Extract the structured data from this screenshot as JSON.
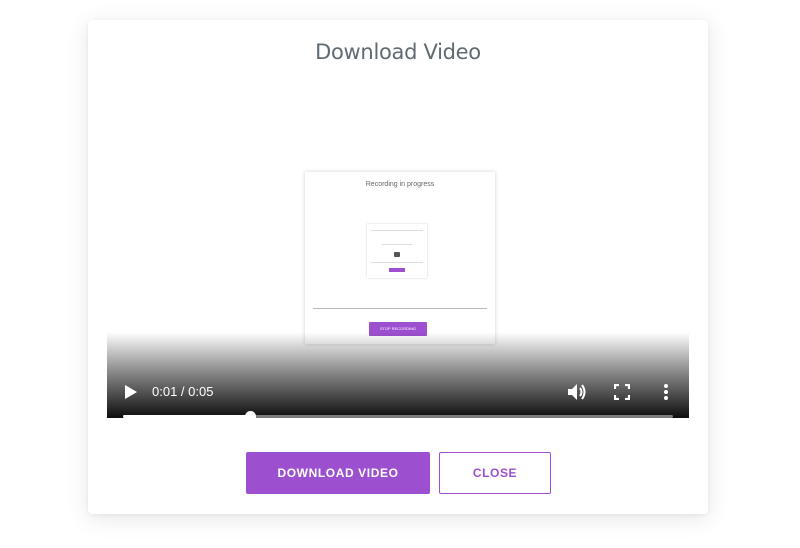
{
  "modal": {
    "title": "Download Video"
  },
  "video_frame": {
    "title": "Recording in progress",
    "button_label": "STOP RECORDING"
  },
  "player": {
    "time_display": "0:01 / 0:05",
    "progress_fraction": 0.23,
    "icons": [
      "play-icon",
      "volume-icon",
      "fullscreen-icon",
      "more-vert-icon"
    ]
  },
  "actions": {
    "download_label": "DOWNLOAD VIDEO",
    "close_label": "CLOSE"
  },
  "colors": {
    "accent": "#9c4fcf",
    "title_text": "#5f6a73"
  }
}
